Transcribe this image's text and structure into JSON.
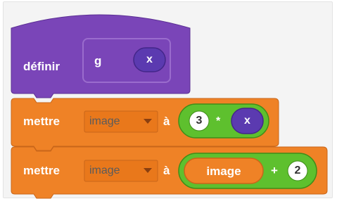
{
  "define_block": {
    "keyword": "définir",
    "proc_name": "g",
    "param": "x"
  },
  "set_block_1": {
    "keyword": "mettre",
    "variable": "image",
    "preposition": "à",
    "left_value": "3",
    "operator": "*",
    "right_param": "x"
  },
  "set_block_2": {
    "keyword": "mettre",
    "variable": "image",
    "preposition": "à",
    "left_var": "image",
    "operator": "+",
    "right_value": "2"
  },
  "colors": {
    "define": "#7a45b8",
    "define_dark": "#5b2f93",
    "data": "#ef8226",
    "data_dark": "#c8661a",
    "operator": "#5ec02e",
    "operator_dark": "#3f8d19",
    "param": "#5b3ab0"
  },
  "icons": {
    "dropdown": "triangle-down"
  }
}
